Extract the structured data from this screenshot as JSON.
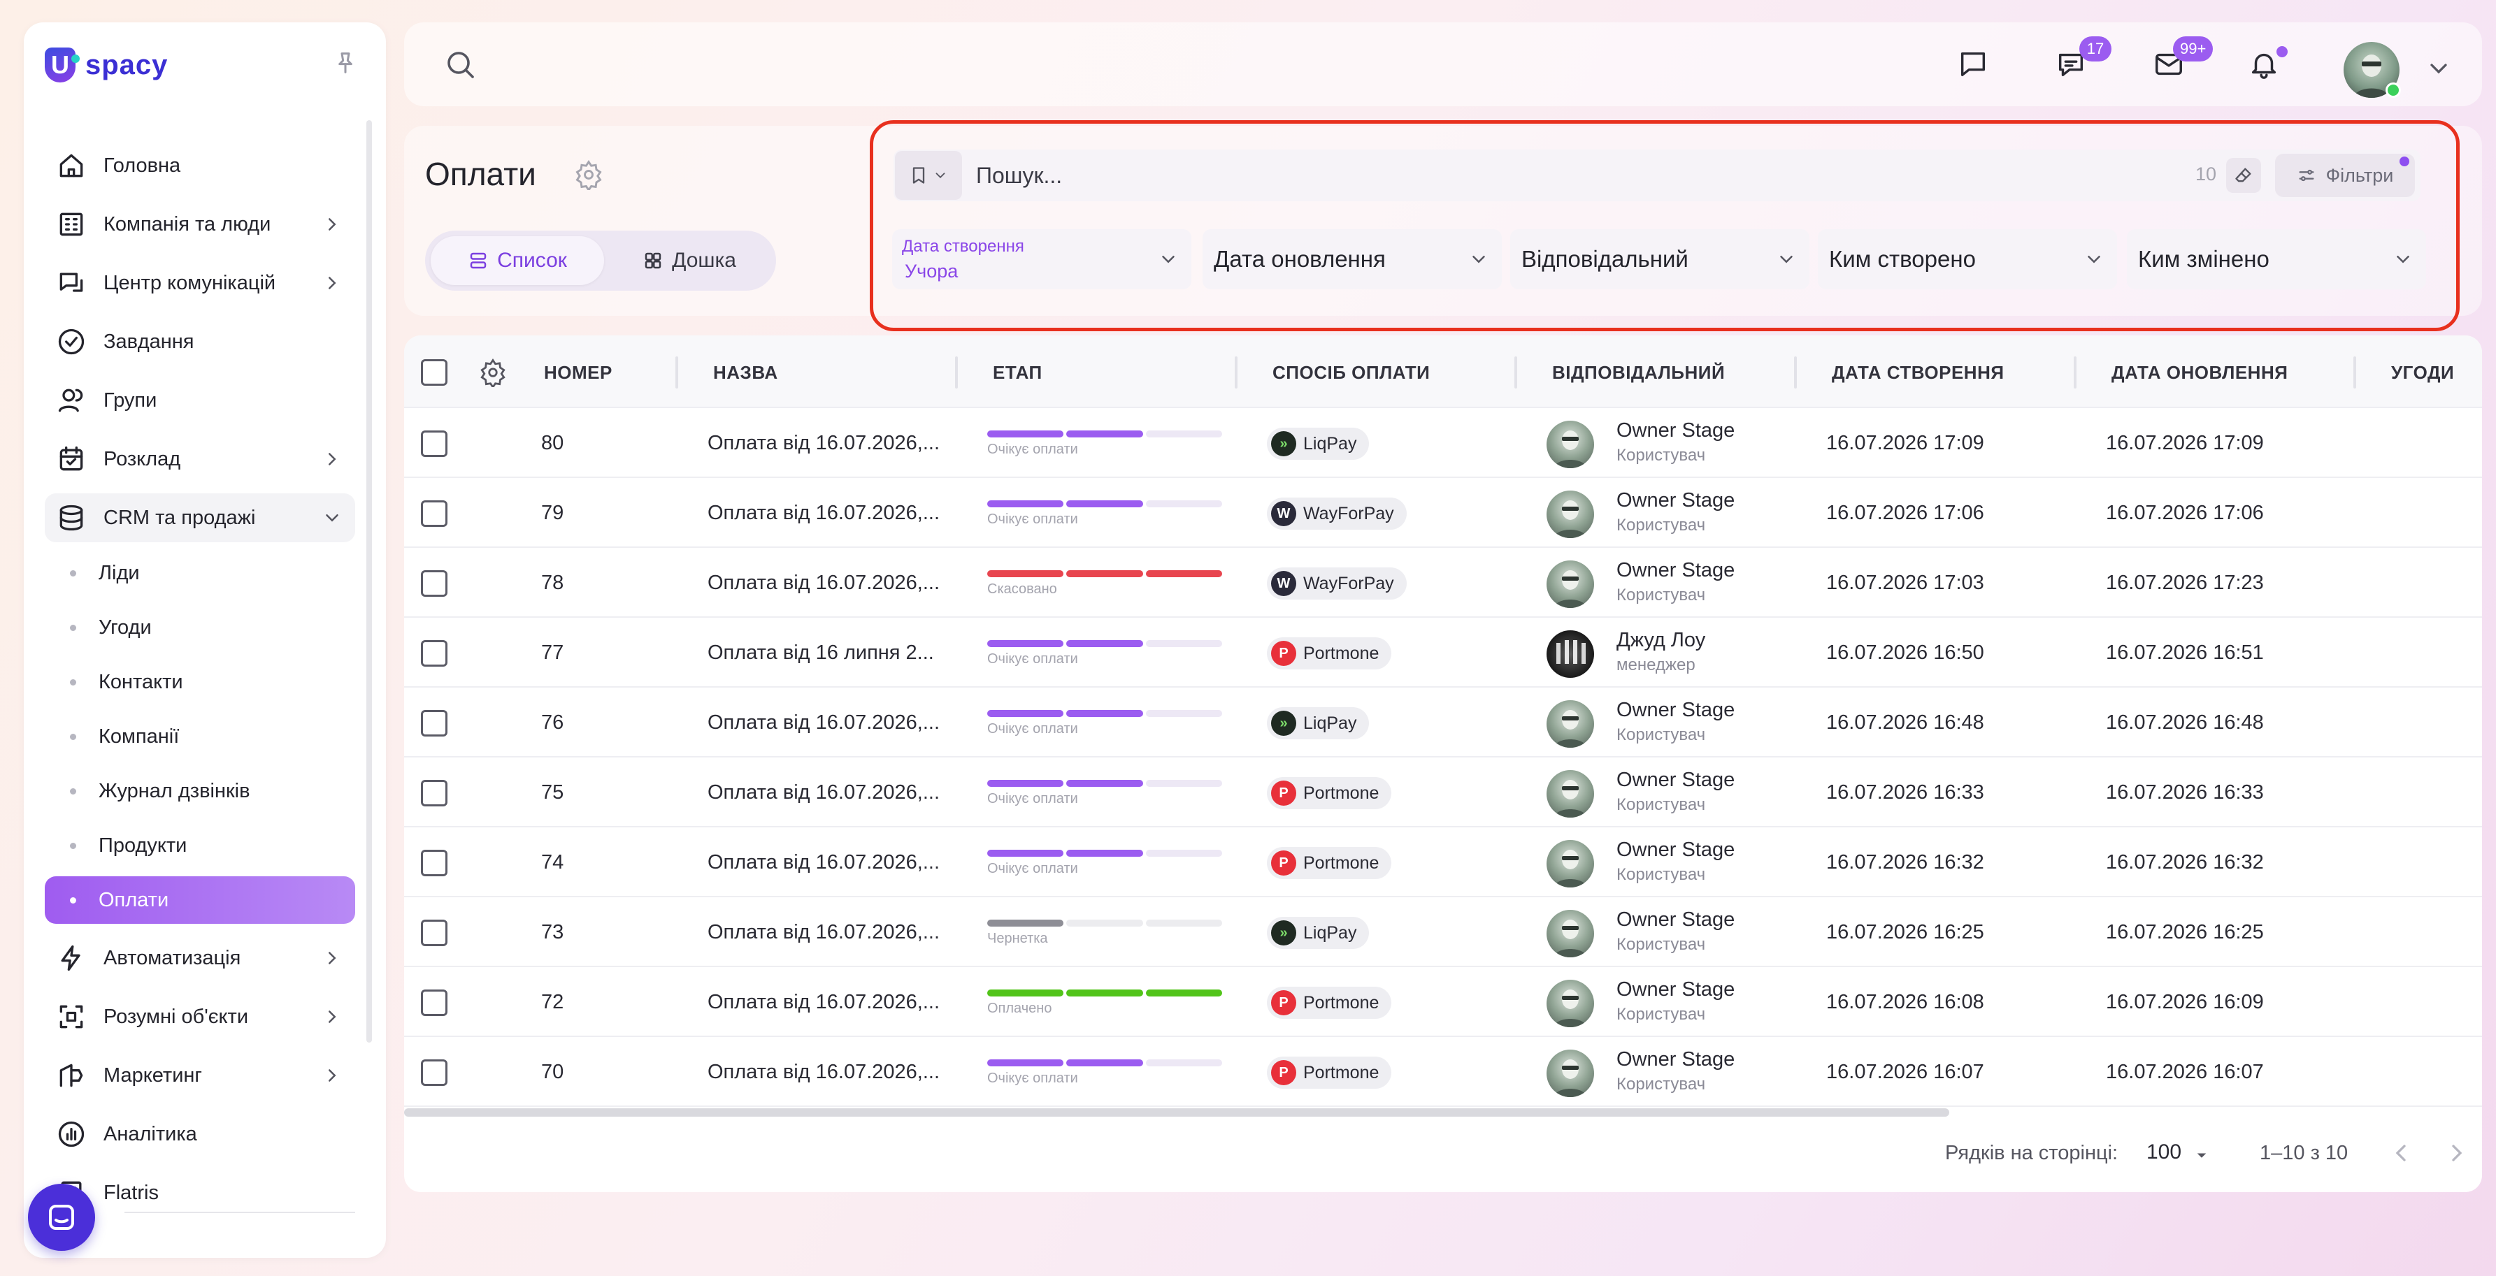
{
  "app": {
    "logo_text": "spacy",
    "logo_letter": "U"
  },
  "colors": {
    "accent": "#9b5cf0",
    "danger": "#e8454f",
    "success": "#52c41a",
    "highlight": "#e8301e"
  },
  "sidebar": {
    "items": [
      {
        "label": "Головна",
        "icon": "home-icon",
        "chevron": false
      },
      {
        "label": "Компанія та люди",
        "icon": "building-icon",
        "chevron": true
      },
      {
        "label": "Центр комунікацій",
        "icon": "chat-icon",
        "chevron": true
      },
      {
        "label": "Завдання",
        "icon": "check-circle-icon",
        "chevron": false
      },
      {
        "label": "Групи",
        "icon": "users-icon",
        "chevron": false
      },
      {
        "label": "Розклад",
        "icon": "calendar-icon",
        "chevron": true
      },
      {
        "label": "CRM та продажі",
        "icon": "database-icon",
        "chevron": true,
        "open": true
      }
    ],
    "sub_items": [
      {
        "label": "Ліди"
      },
      {
        "label": "Угоди"
      },
      {
        "label": "Контакти"
      },
      {
        "label": "Компанії"
      },
      {
        "label": "Журнал дзвінків"
      },
      {
        "label": "Продукти"
      },
      {
        "label": "Оплати",
        "active": true
      }
    ],
    "items_after": [
      {
        "label": "Автоматизація",
        "icon": "bolt-icon",
        "chevron": true
      },
      {
        "label": "Розумні об'єкти",
        "icon": "smart-object-icon",
        "chevron": true
      },
      {
        "label": "Маркетинг",
        "icon": "marketing-icon",
        "chevron": true
      },
      {
        "label": "Аналітика",
        "icon": "analytics-icon",
        "chevron": false
      },
      {
        "label": "Flatris",
        "icon": "flatris-icon",
        "chevron": false
      }
    ]
  },
  "topbar": {
    "messages_badge": "17",
    "mail_badge": "99+"
  },
  "page": {
    "title": "Оплати",
    "view_list": "Список",
    "view_board": "Дошка"
  },
  "filters": {
    "search_placeholder": "Пошук...",
    "count": "10",
    "filters_label": "Фільтри",
    "created_date_label": "Дата створення",
    "created_date_value": "Учора",
    "updated_date": "Дата оновлення",
    "responsible": "Відповідальний",
    "created_by": "Ким створено",
    "changed_by": "Ким змінено"
  },
  "table": {
    "headers": {
      "number": "НОМЕР",
      "name": "НАЗВА",
      "stage": "ЕТАП",
      "payment_method": "СПОСІБ ОПЛАТИ",
      "responsible": "ВІДПОВІДАЛЬНИЙ",
      "created": "ДАТА СТВОРЕННЯ",
      "updated": "ДАТА ОНОВЛЕННЯ",
      "deals": "УГОДИ"
    },
    "rows": [
      {
        "number": "80",
        "name": "Оплата від 16.07.2026,...",
        "stage": "Очікує оплати",
        "stage_type": "pending",
        "method": "LiqPay",
        "resp_name": "Owner Stage",
        "resp_role": "Користувач",
        "created": "16.07.2026 17:09",
        "updated": "16.07.2026 17:09"
      },
      {
        "number": "79",
        "name": "Оплата від 16.07.2026,...",
        "stage": "Очікує оплати",
        "stage_type": "pending",
        "method": "WayForPay",
        "resp_name": "Owner Stage",
        "resp_role": "Користувач",
        "created": "16.07.2026 17:06",
        "updated": "16.07.2026 17:06"
      },
      {
        "number": "78",
        "name": "Оплата від 16.07.2026,...",
        "stage": "Скасовано",
        "stage_type": "cancelled",
        "method": "WayForPay",
        "resp_name": "Owner Stage",
        "resp_role": "Користувач",
        "created": "16.07.2026 17:03",
        "updated": "16.07.2026 17:23"
      },
      {
        "number": "77",
        "name": "Оплата від 16 липня 2...",
        "stage": "Очікує оплати",
        "stage_type": "pending",
        "method": "Portmone",
        "resp_name": "Джуд Лоу",
        "resp_role": "менеджер",
        "created": "16.07.2026 16:50",
        "updated": "16.07.2026 16:51"
      },
      {
        "number": "76",
        "name": "Оплата від 16.07.2026,...",
        "stage": "Очікує оплати",
        "stage_type": "pending",
        "method": "LiqPay",
        "resp_name": "Owner Stage",
        "resp_role": "Користувач",
        "created": "16.07.2026 16:48",
        "updated": "16.07.2026 16:48"
      },
      {
        "number": "75",
        "name": "Оплата від 16.07.2026,...",
        "stage": "Очікує оплати",
        "stage_type": "pending",
        "method": "Portmone",
        "resp_name": "Owner Stage",
        "resp_role": "Користувач",
        "created": "16.07.2026 16:33",
        "updated": "16.07.2026 16:33"
      },
      {
        "number": "74",
        "name": "Оплата від 16.07.2026,...",
        "stage": "Очікує оплати",
        "stage_type": "pending",
        "method": "Portmone",
        "resp_name": "Owner Stage",
        "resp_role": "Користувач",
        "created": "16.07.2026 16:32",
        "updated": "16.07.2026 16:32"
      },
      {
        "number": "73",
        "name": "Оплата від 16.07.2026,...",
        "stage": "Чернетка",
        "stage_type": "draft",
        "method": "LiqPay",
        "resp_name": "Owner Stage",
        "resp_role": "Користувач",
        "created": "16.07.2026 16:25",
        "updated": "16.07.2026 16:25"
      },
      {
        "number": "72",
        "name": "Оплата від 16.07.2026,...",
        "stage": "Оплачено",
        "stage_type": "paid",
        "method": "Portmone",
        "resp_name": "Owner Stage",
        "resp_role": "Користувач",
        "created": "16.07.2026 16:08",
        "updated": "16.07.2026 16:09"
      },
      {
        "number": "70",
        "name": "Оплата від 16.07.2026,...",
        "stage": "Очікує оплати",
        "stage_type": "pending",
        "method": "Portmone",
        "resp_name": "Owner Stage",
        "resp_role": "Користувач",
        "created": "16.07.2026 16:07",
        "updated": "16.07.2026 16:07"
      }
    ]
  },
  "pagination": {
    "rows_per_page_label": "Рядків на сторінці:",
    "rows_per_page": "100",
    "range": "1–10 з 10"
  }
}
